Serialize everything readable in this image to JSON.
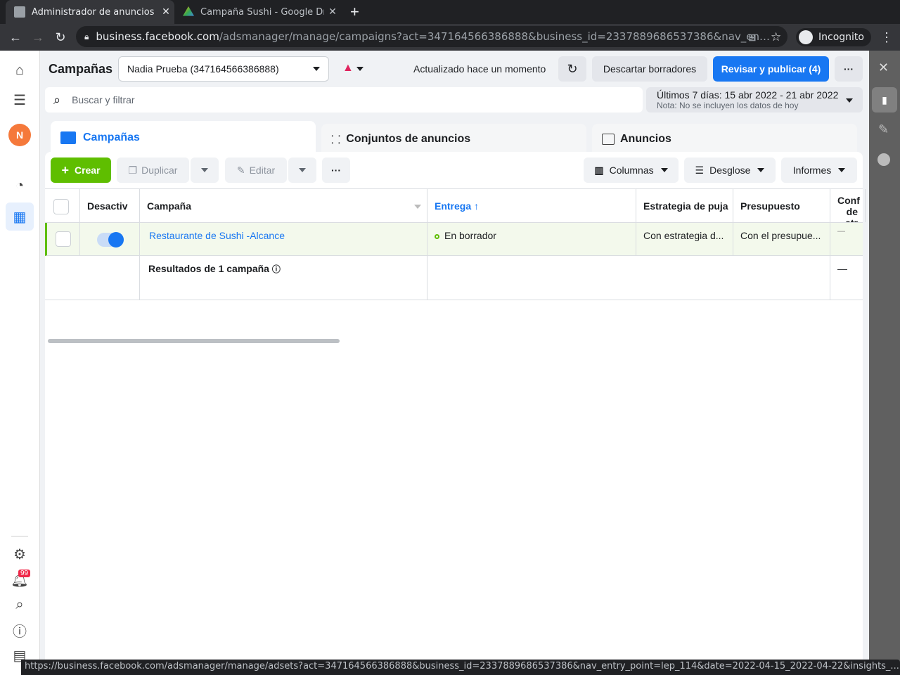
{
  "browser": {
    "tabs": [
      {
        "title": "Administrador de anuncios"
      },
      {
        "title": "Campaña Sushi - Google Drive"
      }
    ],
    "url_host": "business.facebook.com",
    "url_path": "/adsmanager/manage/campaigns?act=347164566386888&business_id=2337889686537386&nav_en…",
    "incognito": "Incognito",
    "status_url": "https://business.facebook.com/adsmanager/manage/adsets?act=347164566386888&business_id=2337889686537386&nav_entry_point=lep_114&date=2022-04-15_2022-04-22&insights_..."
  },
  "sidebar": {
    "avatar": "N",
    "notifications": "99"
  },
  "header": {
    "title": "Campañas",
    "account": "Nadia Prueba (347164566386888)",
    "updated": "Actualizado hace un momento",
    "discard": "Descartar borradores",
    "publish": "Revisar y publicar (4)",
    "more": "···"
  },
  "search": {
    "placeholder": "Buscar y filtrar"
  },
  "date": {
    "range": "Últimos 7 días: 15 abr 2022 - 21 abr 2022",
    "note": "Nota: No se incluyen los datos de hoy"
  },
  "tabs": [
    {
      "label": "Campañas"
    },
    {
      "label": "Conjuntos de anuncios"
    },
    {
      "label": "Anuncios"
    }
  ],
  "actions": {
    "create": "Crear",
    "duplicate": "Duplicar",
    "edit": "Editar",
    "more": "···",
    "columns": "Columnas",
    "breakdown": "Desglose",
    "reports": "Informes"
  },
  "table": {
    "headers": [
      "Desactiv",
      "Campaña",
      "Entrega",
      "Estrategia de puja",
      "Presupuesto",
      "Conf de atr"
    ],
    "rows": [
      {
        "name": "Restaurante de Sushi -Alcance",
        "delivery": "En borrador",
        "bid": "Con estrategia d...",
        "budget": "Con el presupue...",
        "attr": "—",
        "active": true
      }
    ],
    "summary": {
      "label": "Resultados de 1 campaña",
      "attr": "—"
    }
  },
  "colors": {
    "accent": "#1877f2",
    "create": "#5fbe00"
  }
}
